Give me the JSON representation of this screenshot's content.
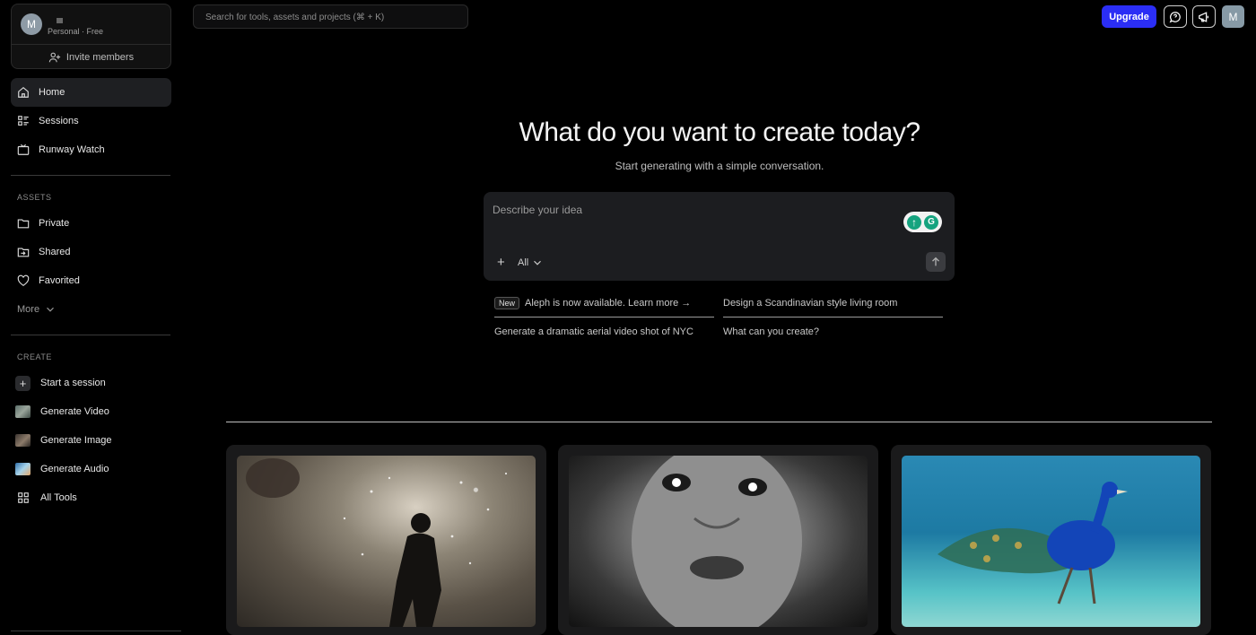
{
  "account": {
    "avatar_initial": "M",
    "plan": "Personal · Free",
    "invite_label": "Invite members"
  },
  "nav": {
    "items": [
      {
        "label": "Home",
        "icon": "home-icon"
      },
      {
        "label": "Sessions",
        "icon": "sessions-icon"
      },
      {
        "label": "Runway Watch",
        "icon": "tv-icon"
      }
    ]
  },
  "assets": {
    "heading": "ASSETS",
    "items": [
      {
        "label": "Private",
        "icon": "folder-icon"
      },
      {
        "label": "Shared",
        "icon": "shared-folder-icon"
      },
      {
        "label": "Favorited",
        "icon": "heart-icon"
      }
    ],
    "more_label": "More"
  },
  "create": {
    "heading": "CREATE",
    "items": [
      {
        "label": "Start a session",
        "icon": "plus-icon"
      },
      {
        "label": "Generate Video",
        "icon": "video-thumbnail"
      },
      {
        "label": "Generate Image",
        "icon": "image-thumbnail"
      },
      {
        "label": "Generate Audio",
        "icon": "audio-thumbnail"
      },
      {
        "label": "All Tools",
        "icon": "grid-icon"
      }
    ]
  },
  "topbar": {
    "search_placeholder": "Search for tools, assets and projects (⌘ + K)",
    "upgrade_label": "Upgrade",
    "avatar_initial": "M"
  },
  "hero": {
    "title": "What do you want to create today?",
    "subtitle": "Start generating with a simple conversation."
  },
  "prompt": {
    "placeholder": "Describe your idea",
    "filter_label": "All",
    "assist_letter": "G"
  },
  "suggestions": {
    "new_badge": "New",
    "items": [
      "Aleph is now available. Learn more →",
      "Design a Scandinavian style living room",
      "Generate a dramatic aerial video shot of NYC",
      "What can you create?"
    ]
  },
  "colors": {
    "accent": "#2b2ef5",
    "background": "#000000",
    "active_nav": "#1e1f22"
  }
}
